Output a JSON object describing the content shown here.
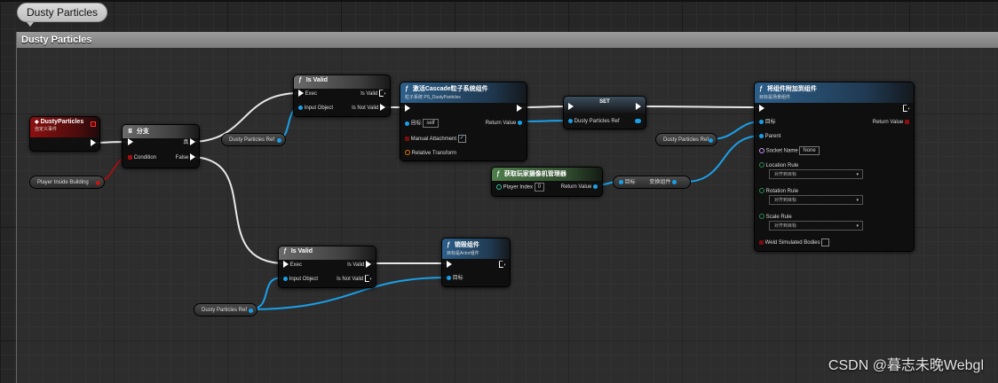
{
  "graph": {
    "tab_label": "Dusty Particles",
    "comment_title": "Dusty Particles"
  },
  "colors": {
    "exec": "#ffffff",
    "object": "#1a9ee5",
    "boolean": "#8c0e0e",
    "name": "#cc99ff",
    "vector": "#2e8b57"
  },
  "event_node": {
    "title": "DustyParticles",
    "subtitle": "自定义事件"
  },
  "branch_node": {
    "title": "分支",
    "condition": "Condition",
    "true_label": "真",
    "false_label": "False"
  },
  "is_valid_top": {
    "title": "Is Valid",
    "exec": "Exec",
    "is_valid": "Is Valid",
    "input_object": "Input Object",
    "is_not_valid": "Is Not Valid"
  },
  "is_valid_bottom": {
    "title": "Is Valid",
    "exec": "Exec",
    "is_valid": "Is Valid",
    "input_object": "Input Object",
    "is_not_valid": "Is Not Valid"
  },
  "activate_node": {
    "title": "激活Cascade粒子系统组件",
    "subtitle": "粒子系统 PS_DustyParticles",
    "target": "目标",
    "target_value": "self",
    "return_value": "Return Value",
    "manual_attachment": "Manual Attachment",
    "relative_transform": "Relative Transform"
  },
  "set_node": {
    "title": "SET",
    "pin": "Dusty Particles Ref"
  },
  "camera_node": {
    "title": "获取玩家摄像机管理器",
    "player_index": "Player Index",
    "player_index_value": "0",
    "return_value": "Return Value"
  },
  "transform_node": {
    "target": "目标",
    "out": "变换组件"
  },
  "attach_node": {
    "title": "将组件附加到组件",
    "subtitle": "目标是场景组件",
    "target": "目标",
    "return_value": "Return Value",
    "parent": "Parent",
    "socket_name": "Socket Name",
    "socket_value": "None",
    "location_rule": "Location Rule",
    "location_value": "对齐到目标",
    "rotation_rule": "Rotation Rule",
    "rotation_value": "对齐到目标",
    "scale_rule": "Scale Rule",
    "scale_value": "对齐到目标",
    "weld": "Weld Simulated Bodies"
  },
  "destroy_node": {
    "title": "销毁组件",
    "subtitle": "目标是Actor组件",
    "target": "目标"
  },
  "variables": {
    "player_inside_building": "Player Inside Building",
    "dusty_ref_1": "Dusty Particles Ref",
    "dusty_ref_2": "Dusty Particles Ref",
    "dusty_ref_3": "Dusty Particles Ref"
  },
  "watermark": "CSDN @暮志未晚Webgl"
}
